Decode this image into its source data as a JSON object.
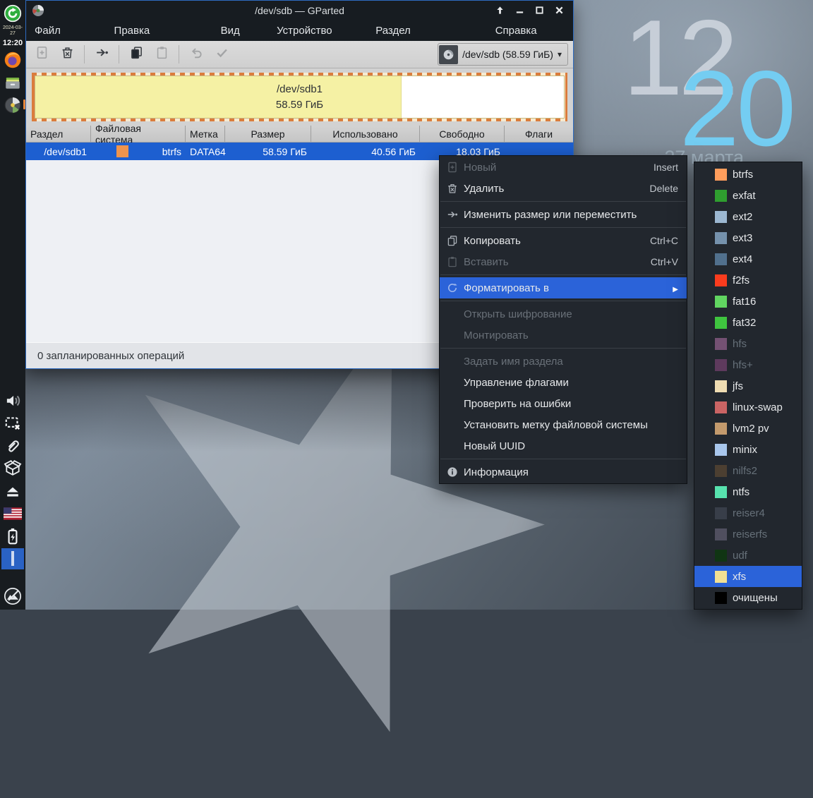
{
  "desktop": {
    "clock_hour": "12",
    "clock_minute": "20",
    "date": "27 марта"
  },
  "dock": {
    "top_items": [
      {
        "name": "update-manager-icon",
        "icon": "update"
      },
      {
        "name": "dock-date",
        "text": "2024-03-27"
      },
      {
        "name": "dock-time",
        "text": "12:20",
        "time": true
      },
      {
        "name": "firefox-icon",
        "icon": "firefox"
      },
      {
        "name": "file-manager-icon",
        "icon": "drawer"
      },
      {
        "name": "gparted-dock-icon",
        "icon": "gparted",
        "indicator": true
      }
    ],
    "bottom_items": [
      {
        "name": "volume-icon",
        "icon": "volume"
      },
      {
        "name": "screenshot-icon",
        "icon": "screenshot"
      },
      {
        "name": "attachment-icon",
        "icon": "clip"
      },
      {
        "name": "package-icon",
        "icon": "box"
      },
      {
        "name": "eject-icon",
        "icon": "eject"
      },
      {
        "name": "keyboard-layout-us-icon",
        "icon": "flagus"
      },
      {
        "name": "battery-icon",
        "icon": "battery"
      },
      {
        "name": "workspace-indicator",
        "icon": "workspace",
        "active": true
      },
      {
        "name": "mx-menu-icon",
        "icon": "mx",
        "mx": true
      }
    ]
  },
  "window": {
    "title": "/dev/sdb — GParted",
    "menubar": [
      "Файл",
      "Правка",
      "Вид",
      "Устройство",
      "Раздел",
      "Справка"
    ],
    "toolbar": {
      "buttons": [
        {
          "name": "new-partition-button",
          "icon": "docnew",
          "disabled": true
        },
        {
          "name": "delete-partition-button",
          "icon": "trash"
        },
        {
          "type": "sep"
        },
        {
          "name": "resize-move-button",
          "icon": "resize"
        },
        {
          "type": "sep"
        },
        {
          "name": "copy-button",
          "icon": "copy"
        },
        {
          "name": "paste-button",
          "icon": "paste",
          "disabled": true
        },
        {
          "type": "sep"
        },
        {
          "name": "undo-button",
          "icon": "undo",
          "disabled": true
        },
        {
          "name": "apply-button",
          "icon": "apply",
          "disabled": true
        }
      ],
      "device_selector_value": "/dev/sdb (58.59 ГиБ)"
    },
    "partition_bar": {
      "device": "/dev/sdb1",
      "size": "58.59 ГиБ",
      "used_percent": 69.2,
      "used_color": "#f5f1a4",
      "selection_border_color": "#db7c3c"
    },
    "table": {
      "headers": [
        "Раздел",
        "Файловая система",
        "Метка",
        "Размер",
        "Использовано",
        "Свободно",
        "Флаги"
      ],
      "row": {
        "partition": "/dev/sdb1",
        "filesystem": "btrfs",
        "filesystem_color": "#ef944d",
        "label": "DATA64",
        "size": "58.59 ГиБ",
        "used": "40.56 ГиБ",
        "free": "18.03 ГиБ",
        "flags": ""
      }
    },
    "statusbar": "0 запланированных операций"
  },
  "context_menu": {
    "items": [
      {
        "name": "menu-item-new",
        "icon": "docnew",
        "label": "Новый",
        "shortcut": "Insert",
        "disabled": true
      },
      {
        "name": "menu-item-delete",
        "icon": "trash",
        "label": "Удалить",
        "shortcut": "Delete"
      },
      {
        "type": "separator"
      },
      {
        "name": "menu-item-resize-move",
        "icon": "resize",
        "label": "Изменить размер или переместить"
      },
      {
        "type": "separator"
      },
      {
        "name": "menu-item-copy",
        "icon": "copy",
        "label": "Копировать",
        "shortcut": "Ctrl+C"
      },
      {
        "name": "menu-item-paste",
        "icon": "paste",
        "label": "Вставить",
        "shortcut": "Ctrl+V",
        "disabled": true
      },
      {
        "type": "separator"
      },
      {
        "name": "menu-item-format-to",
        "icon": "refresh",
        "label": "Форматировать в",
        "submenu": true,
        "highlighted": true
      },
      {
        "type": "separator"
      },
      {
        "name": "menu-item-open-encryption",
        "label": "Открыть шифрование",
        "disabled": true
      },
      {
        "name": "menu-item-mount",
        "label": "Монтировать",
        "disabled": true
      },
      {
        "type": "separator"
      },
      {
        "name": "menu-item-name-partition",
        "label": "Задать имя раздела",
        "disabled": true
      },
      {
        "name": "menu-item-manage-flags",
        "label": "Управление флагами"
      },
      {
        "name": "menu-item-check-errors",
        "label": "Проверить на ошибки"
      },
      {
        "name": "menu-item-set-fs-label",
        "label": "Установить метку файловой системы"
      },
      {
        "name": "menu-item-new-uuid",
        "label": "Новый UUID"
      },
      {
        "type": "separator"
      },
      {
        "name": "menu-item-information",
        "icon": "info",
        "label": "Информация"
      }
    ]
  },
  "format_submenu": {
    "items": [
      {
        "name": "format-option-btrfs",
        "label": "btrfs",
        "color": "#ff9d5c"
      },
      {
        "name": "format-option-exfat",
        "label": "exfat",
        "color": "#2f9e2f"
      },
      {
        "name": "format-option-ext2",
        "label": "ext2",
        "color": "#9cb7d1"
      },
      {
        "name": "format-option-ext3",
        "label": "ext3",
        "color": "#7591ac"
      },
      {
        "name": "format-option-ext4",
        "label": "ext4",
        "color": "#51708d"
      },
      {
        "name": "format-option-f2fs",
        "label": "f2fs",
        "color": "#fb3c1e"
      },
      {
        "name": "format-option-fat16",
        "label": "fat16",
        "color": "#61d561"
      },
      {
        "name": "format-option-fat32",
        "label": "fat32",
        "color": "#3fc43f"
      },
      {
        "name": "format-option-hfs",
        "label": "hfs",
        "color": "#8a5d84",
        "disabled": true
      },
      {
        "name": "format-option-hfsplus",
        "label": "hfs+",
        "color": "#6e4069",
        "disabled": true
      },
      {
        "name": "format-option-jfs",
        "label": "jfs",
        "color": "#efdcb2"
      },
      {
        "name": "format-option-linux-swap",
        "label": "linux-swap",
        "color": "#ca6464"
      },
      {
        "name": "format-option-lvm2pv",
        "label": "lvm2 pv",
        "color": "#c39a6d"
      },
      {
        "name": "format-option-minix",
        "label": "minix",
        "color": "#a8c6ec"
      },
      {
        "name": "format-option-nilfs2",
        "label": "nilfs2",
        "color": "#584632",
        "disabled": true
      },
      {
        "name": "format-option-ntfs",
        "label": "ntfs",
        "color": "#57e2ae"
      },
      {
        "name": "format-option-reiser4",
        "label": "reiser4",
        "color": "#3e4550",
        "disabled": true
      },
      {
        "name": "format-option-reiserfs",
        "label": "reiserfs",
        "color": "#5d5a6c",
        "disabled": true
      },
      {
        "name": "format-option-udf",
        "label": "udf",
        "color": "#0d3a0d",
        "disabled": true
      },
      {
        "name": "format-option-xfs",
        "label": "xfs",
        "color": "#f2e093",
        "highlighted": true
      },
      {
        "name": "format-option-cleared",
        "label": "очищены",
        "color": "#000000"
      }
    ]
  }
}
